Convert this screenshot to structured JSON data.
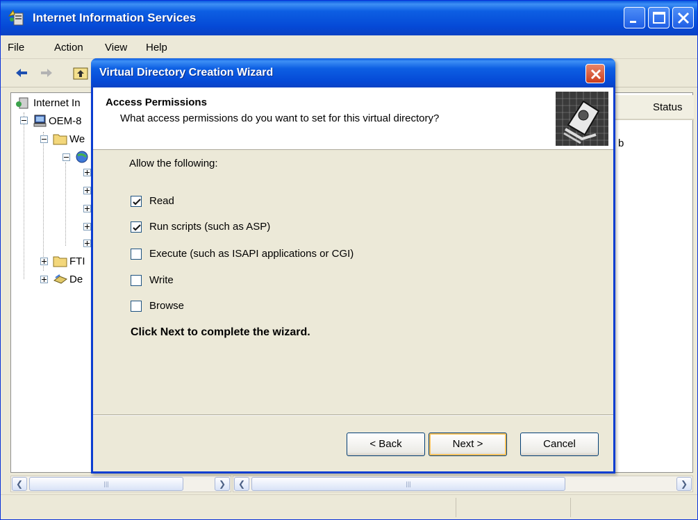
{
  "app": {
    "title": "Internet Information Services",
    "menu": [
      "File",
      "Action",
      "View",
      "Help"
    ]
  },
  "tree": {
    "items": [
      {
        "label": "Internet In"
      },
      {
        "label": "OEM-8"
      },
      {
        "label": "We"
      },
      {
        "label": "FTI"
      },
      {
        "label": "De"
      }
    ]
  },
  "list": {
    "status_header": "Status",
    "partial_text": "b"
  },
  "wizard": {
    "title": "Virtual Directory Creation Wizard",
    "header_title": "Access Permissions",
    "header_subtitle": "What access permissions do you want to set for this virtual directory?",
    "allow_label": "Allow the following:",
    "permissions": [
      {
        "label": "Read",
        "checked": true
      },
      {
        "label": "Run scripts (such as ASP)",
        "checked": true
      },
      {
        "label": "Execute (such as ISAPI applications or CGI)",
        "checked": false
      },
      {
        "label": "Write",
        "checked": false
      },
      {
        "label": "Browse",
        "checked": false
      }
    ],
    "hint": "Click Next to complete the wizard.",
    "buttons": {
      "back": "< Back",
      "next": "Next >",
      "cancel": "Cancel"
    }
  },
  "colors": {
    "titlebar": "#0549d6",
    "window_bg": "#ece9d8",
    "close_button": "#cc3f1c"
  }
}
